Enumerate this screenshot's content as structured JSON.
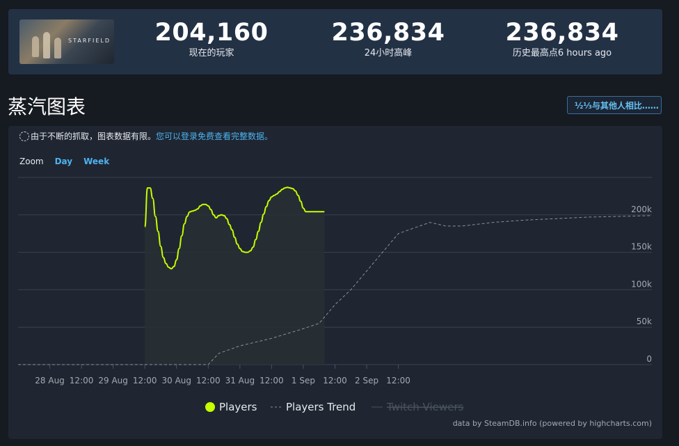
{
  "stats": {
    "current": {
      "value": "204,160",
      "label": "现在的玩家"
    },
    "peak24": {
      "value": "236,834",
      "label": "24小时高峰"
    },
    "alltime": {
      "value": "236,834",
      "label": "历史最高点6 hours ago"
    }
  },
  "game_logo_text": "STARFIELD",
  "section_title": "蒸汽图表",
  "compare_label": "½⅓与其他人相比……",
  "notice": {
    "text": "由于不断的抓取，图表数据有限。",
    "link": "您可以登录免费查看完整数据。"
  },
  "zoom": {
    "label": "Zoom",
    "day": "Day",
    "week": "Week"
  },
  "colors": {
    "players": "#c6ff00",
    "trend": "#8a909a",
    "twitch": "#4a5260",
    "link": "#4eb2ef"
  },
  "chart_data": {
    "type": "line",
    "x_ticks": [
      "28 Aug",
      "12:00",
      "29 Aug",
      "12:00",
      "30 Aug",
      "12:00",
      "31 Aug",
      "12:00",
      "1 Sep",
      "12:00",
      "2 Sep",
      "12:00"
    ],
    "y_ticks": [
      "0",
      "50k",
      "100k",
      "150k",
      "200k"
    ],
    "ylim": [
      0,
      250000
    ],
    "x_range_hours": [
      -48,
      192
    ],
    "legend": [
      "Players",
      "Players Trend",
      "Twitch Viewers"
    ],
    "legend_placement": "bottom",
    "series": [
      {
        "name": "Players",
        "x_hours": [
          0,
          1,
          2,
          3,
          4,
          5,
          6,
          7,
          8,
          9,
          10,
          11,
          12,
          13,
          14,
          15,
          16,
          17,
          18,
          19,
          20,
          21,
          22,
          23,
          24,
          25,
          26,
          27,
          28,
          29,
          30,
          31,
          32,
          33,
          34,
          35,
          36,
          37,
          38,
          39,
          40,
          41,
          42,
          43,
          44,
          45,
          46,
          47,
          48,
          49,
          50,
          51,
          52,
          53,
          54,
          55,
          56,
          57,
          58,
          59,
          60,
          61,
          62,
          63,
          64,
          65,
          66,
          67,
          68
        ],
        "values": [
          184000,
          236000,
          236000,
          222000,
          198000,
          178000,
          158000,
          143000,
          135000,
          130000,
          128000,
          131000,
          140000,
          155000,
          172000,
          188000,
          198000,
          204000,
          205000,
          206000,
          208000,
          212000,
          214000,
          214000,
          212000,
          207000,
          200000,
          196000,
          199000,
          200000,
          199000,
          195000,
          187000,
          180000,
          170000,
          161000,
          155000,
          151000,
          150000,
          150000,
          152000,
          157000,
          167000,
          178000,
          190000,
          201000,
          211000,
          219000,
          224000,
          226000,
          228000,
          231000,
          234000,
          236000,
          236834,
          236000,
          235000,
          232000,
          226000,
          218000,
          209000,
          204160,
          204160,
          204160,
          204160,
          204160,
          204160,
          204160,
          204160
        ]
      },
      {
        "name": "Players Trend",
        "x_hours": [
          -48,
          24,
          28,
          36,
          48,
          60,
          66,
          72,
          78,
          84,
          96,
          108,
          114,
          120,
          132,
          144,
          156,
          168,
          180,
          192
        ],
        "values": [
          0,
          0,
          15000,
          25000,
          35000,
          48000,
          55000,
          80000,
          100000,
          125000,
          175000,
          190000,
          185000,
          185000,
          190000,
          193000,
          195000,
          197000,
          198000,
          199000
        ]
      }
    ]
  },
  "credit": "data by SteamDB.info (powered by highcharts.com)"
}
